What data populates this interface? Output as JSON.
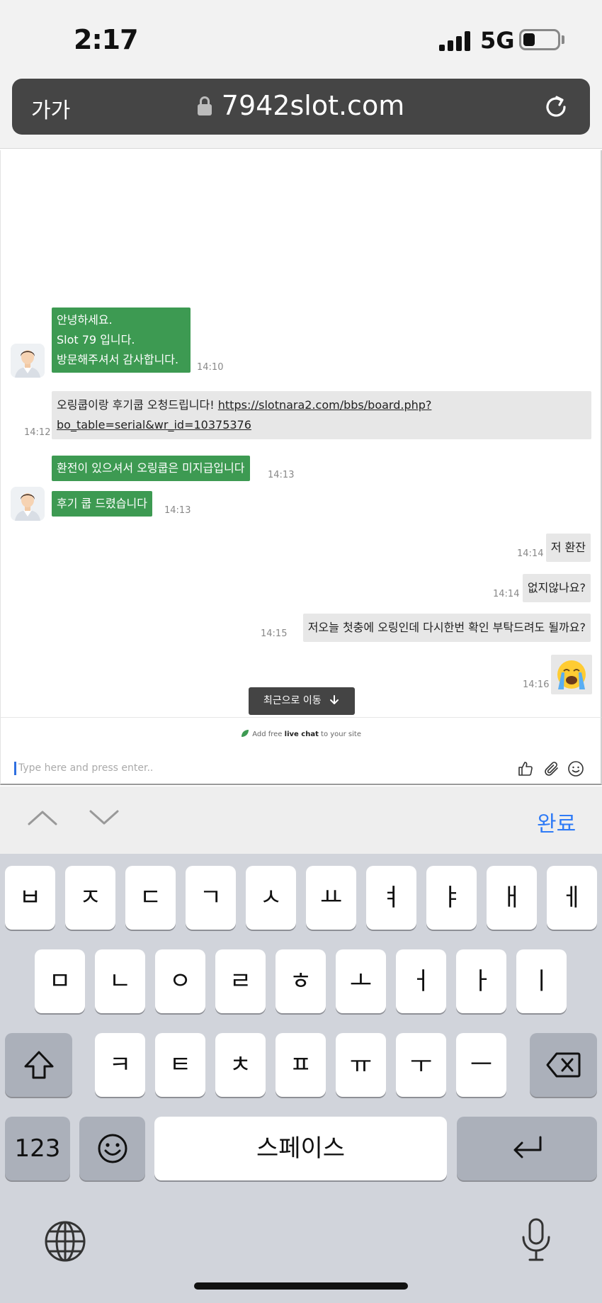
{
  "status_bar": {
    "time": "2:17",
    "network": "5G"
  },
  "browser": {
    "text_size_label": "가가",
    "url": "7942slot.com"
  },
  "chat": {
    "messages": [
      {
        "lines": [
          "안녕하세요.",
          "Slot 79 입니다.",
          "방문해주셔서 감사합니다."
        ],
        "time": "14:10"
      },
      {
        "text_prefix": "오링쿱이랑 후기쿱 오청드립니다! ",
        "link_line1": "https://slotnara2.com/bbs/board.php?",
        "link_line2": "bo_table=serial&wr_id=10375376",
        "time": "14:12"
      },
      {
        "text": "환전이 있으셔서 오링쿱은 미지급입니다",
        "time": "14:13"
      },
      {
        "text": "후기 쿱 드렸습니다",
        "time": "14:13"
      },
      {
        "text": "저 환잔",
        "time": "14:14"
      },
      {
        "text": "없지않나요?",
        "time": "14:14"
      },
      {
        "text": "저오늘 첫충에 오링인데 다시한번 확인 부탁드려도 될까요?",
        "time": "14:15"
      },
      {
        "emoji": "crying-face",
        "time": "14:16"
      }
    ],
    "jump_button": "최근으로 이동",
    "powered_by": {
      "pre": "Add free ",
      "bold": "live chat",
      "post": " to your site"
    },
    "input_placeholder": "Type here and press enter.."
  },
  "accessory_bar": {
    "done_label": "완료"
  },
  "keyboard": {
    "row1": [
      "ㅂ",
      "ㅈ",
      "ㄷ",
      "ㄱ",
      "ㅅ",
      "ㅛ",
      "ㅕ",
      "ㅑ",
      "ㅐ",
      "ㅔ"
    ],
    "row2": [
      "ㅁ",
      "ㄴ",
      "ㅇ",
      "ㄹ",
      "ㅎ",
      "ㅗ",
      "ㅓ",
      "ㅏ",
      "ㅣ"
    ],
    "row3": [
      "ㅋ",
      "ㅌ",
      "ㅊ",
      "ㅍ",
      "ㅠ",
      "ㅜ",
      "ㅡ"
    ],
    "numbers_label": "123",
    "space_label": "스페이스"
  },
  "colors": {
    "agent_bubble": "#3d9a52",
    "user_bubble": "#e7e7e7",
    "accent": "#2f7bf6"
  }
}
